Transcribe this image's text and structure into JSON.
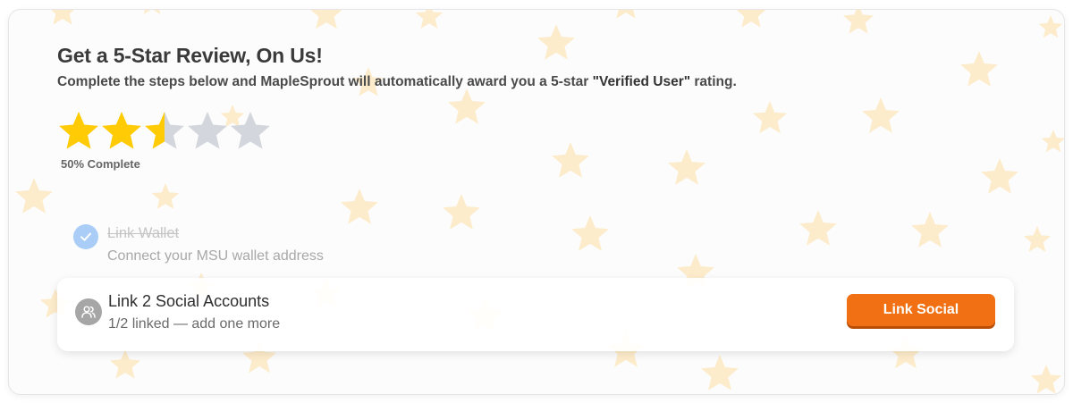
{
  "card": {
    "title": "Get a 5-Star Review, On Us!",
    "subtitle_before": "Complete the steps below and MapleSprout will automatically award you a 5-star ",
    "subtitle_emphasis": "\"Verified User\"",
    "subtitle_after": " rating."
  },
  "rating": {
    "max_stars": 5,
    "value": 2.5,
    "progress_label": "50% Complete"
  },
  "steps": [
    {
      "title": "Link Wallet",
      "description": "Connect your MSU wallet address",
      "completed": true,
      "icon": "check-icon"
    },
    {
      "title": "Link 2 Social Accounts",
      "description": "1/2 linked — add one more",
      "completed": false,
      "icon": "people-icon",
      "action_label": "Link Social"
    }
  ],
  "colors": {
    "star_filled": "#ffcb05",
    "star_empty": "#d3d7dd",
    "background_star": "#fdeccb",
    "accent": "#f07013",
    "accent_shadow": "#b94e07",
    "check_badge": "#a9cdf6"
  }
}
